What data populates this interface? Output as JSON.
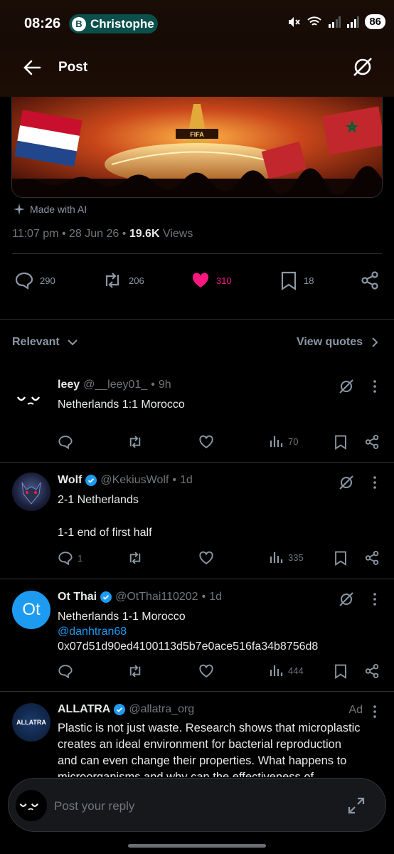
{
  "status_bar": {
    "time": "08:26",
    "pill_initial": "B",
    "pill_text": "Christophe",
    "battery": "86"
  },
  "header": {
    "title": "Post"
  },
  "post": {
    "made_with": "Made with AI",
    "time": "11:07 pm",
    "date": "28 Jun 26",
    "views_count": "19.6K",
    "views_label": "Views",
    "stats": {
      "replies": "290",
      "reposts": "206",
      "likes": "310",
      "bookmarks": "18"
    }
  },
  "filter": {
    "relevant": "Relevant",
    "view_quotes": "View quotes"
  },
  "tweets": [
    {
      "name": "leey",
      "handle": "@__leey01_",
      "time": "9h",
      "verified": false,
      "text": [
        "Netherlands 1:1 Morocco"
      ],
      "replies": "",
      "views": "70"
    },
    {
      "name": "Wolf",
      "handle": "@KekiusWolf",
      "time": "1d",
      "verified": true,
      "text": [
        "2-1 Netherlands",
        "1-1 end of first half"
      ],
      "replies": "1",
      "views": "335"
    },
    {
      "name": "Ot Thai",
      "handle": "@OtThai110202",
      "time": "1d",
      "verified": true,
      "avatar_text": "Ot",
      "text": [
        "Netherlands 1-1 Morocco"
      ],
      "mention": "@danhtran68",
      "hash": "0x07d51d90ed4100113d5b7e0ace516fa34b8756d8",
      "replies": "",
      "views": "444"
    },
    {
      "name": "ALLATRA",
      "handle": "@allatra_org",
      "ad": "Ad",
      "verified": true,
      "avatar_text": "ALLATRA",
      "text": [
        "Plastic is not just waste. Research shows that microplastic",
        "creates an ideal environment for bacterial reproduction",
        "and can even change their properties. What happens to",
        "microorganisms and why can the effectiveness of"
      ]
    }
  ],
  "reply_bar": {
    "placeholder": "Post your reply"
  },
  "colors": {
    "like": "#f91880",
    "link": "#1d9bf0",
    "background": "#000000"
  }
}
